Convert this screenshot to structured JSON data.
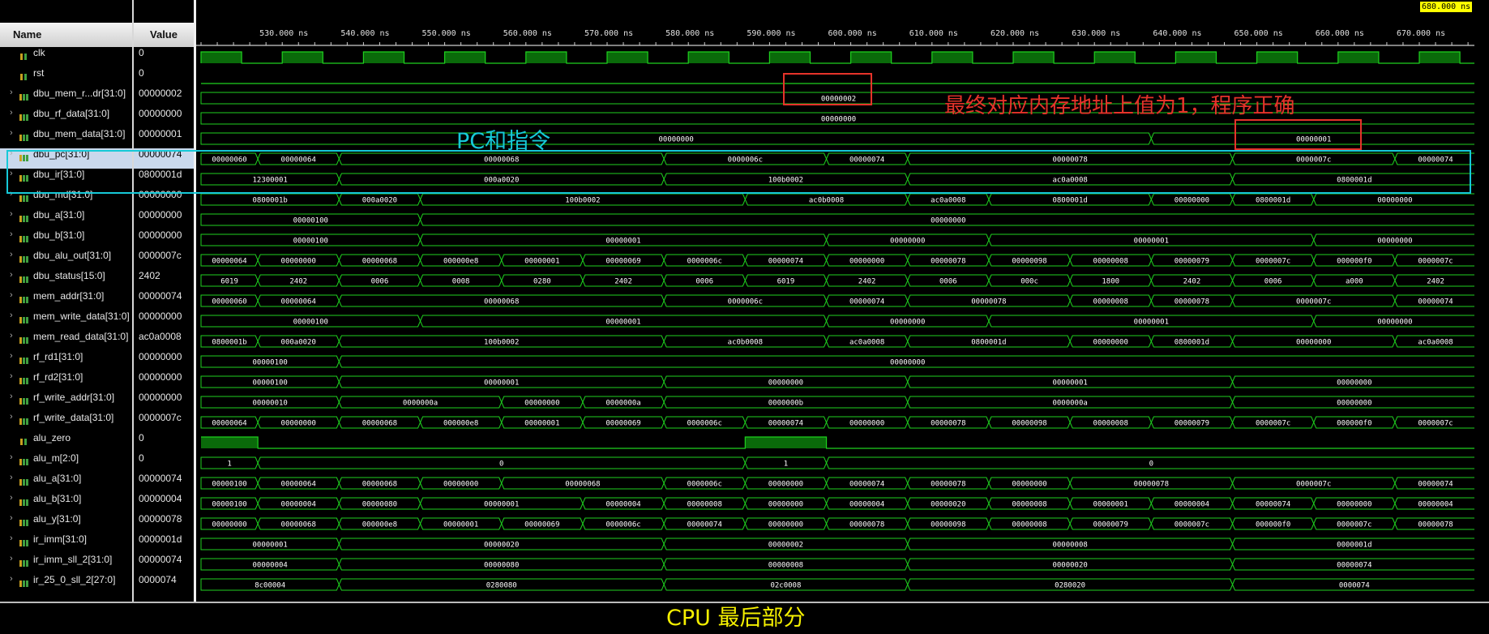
{
  "header": {
    "name_col": "Name",
    "value_col": "Value"
  },
  "ruler": {
    "ticks": [
      "530.000 ns",
      "540.000 ns",
      "550.000 ns",
      "560.000 ns",
      "570.000 ns",
      "580.000 ns",
      "590.000 ns",
      "600.000 ns",
      "610.000 ns",
      "620.000 ns",
      "630.000 ns",
      "640.000 ns",
      "650.000 ns",
      "660.000 ns",
      "670.000 ns",
      "680"
    ],
    "cursor_label": "680.000 ns"
  },
  "signals": [
    {
      "name": "clk",
      "value": "0",
      "kind": "bit",
      "expand": false
    },
    {
      "name": "rst",
      "value": "0",
      "kind": "bit",
      "expand": false
    },
    {
      "name": "dbu_mem_r...dr[31:0]",
      "value": "00000002",
      "kind": "bus",
      "expand": true
    },
    {
      "name": "dbu_rf_data[31:0]",
      "value": "00000000",
      "kind": "bus",
      "expand": true
    },
    {
      "name": "dbu_mem_data[31:0]",
      "value": "00000001",
      "kind": "bus",
      "expand": true
    },
    {
      "name": "dbu_pc[31:0]",
      "value": "00000074",
      "kind": "bus",
      "expand": true,
      "selected": true
    },
    {
      "name": "dbu_ir[31:0]",
      "value": "0800001d",
      "kind": "bus",
      "expand": true
    },
    {
      "name": "dbu_md[31:0]",
      "value": "00000000",
      "kind": "bus",
      "expand": true
    },
    {
      "name": "dbu_a[31:0]",
      "value": "00000000",
      "kind": "bus",
      "expand": true
    },
    {
      "name": "dbu_b[31:0]",
      "value": "00000000",
      "kind": "bus",
      "expand": true
    },
    {
      "name": "dbu_alu_out[31:0]",
      "value": "0000007c",
      "kind": "bus",
      "expand": true
    },
    {
      "name": "dbu_status[15:0]",
      "value": "2402",
      "kind": "bus",
      "expand": true
    },
    {
      "name": "mem_addr[31:0]",
      "value": "00000074",
      "kind": "bus",
      "expand": true
    },
    {
      "name": "mem_write_data[31:0]",
      "value": "00000000",
      "kind": "bus",
      "expand": true
    },
    {
      "name": "mem_read_data[31:0]",
      "value": "ac0a0008",
      "kind": "bus",
      "expand": true
    },
    {
      "name": "rf_rd1[31:0]",
      "value": "00000000",
      "kind": "bus",
      "expand": true
    },
    {
      "name": "rf_rd2[31:0]",
      "value": "00000000",
      "kind": "bus",
      "expand": true
    },
    {
      "name": "rf_write_addr[31:0]",
      "value": "00000000",
      "kind": "bus",
      "expand": true
    },
    {
      "name": "rf_write_data[31:0]",
      "value": "0000007c",
      "kind": "bus",
      "expand": true
    },
    {
      "name": "alu_zero",
      "value": "0",
      "kind": "bit",
      "expand": false
    },
    {
      "name": "alu_m[2:0]",
      "value": "0",
      "kind": "bus",
      "expand": true
    },
    {
      "name": "alu_a[31:0]",
      "value": "00000074",
      "kind": "bus",
      "expand": true
    },
    {
      "name": "alu_b[31:0]",
      "value": "00000004",
      "kind": "bus",
      "expand": true
    },
    {
      "name": "alu_y[31:0]",
      "value": "00000078",
      "kind": "bus",
      "expand": true
    },
    {
      "name": "ir_imm[31:0]",
      "value": "0000001d",
      "kind": "bus",
      "expand": true
    },
    {
      "name": "ir_imm_sll_2[31:0]",
      "value": "00000074",
      "kind": "bus",
      "expand": true
    },
    {
      "name": "ir_25_0_sll_2[27:0]",
      "value": "0000074",
      "kind": "bus",
      "expand": true
    }
  ],
  "waves": {
    "clk": {
      "t0": 523,
      "period": 10,
      "high": 5
    },
    "rst": [],
    "alu_zero": [
      [
        523,
        530,
        1
      ],
      [
        530,
        590,
        0
      ],
      [
        590,
        600,
        1
      ],
      [
        600,
        680,
        0
      ]
    ],
    "dbu_mem_r...dr[31:0]": [
      [
        523,
        680,
        "00000002"
      ]
    ],
    "dbu_rf_data[31:0]": [
      [
        523,
        680,
        "00000000"
      ]
    ],
    "dbu_mem_data[31:0]": [
      [
        523,
        640,
        "00000000"
      ],
      [
        640,
        680,
        "00000001"
      ]
    ],
    "dbu_pc[31:0]": [
      [
        523,
        530,
        "00000060"
      ],
      [
        530,
        540,
        "00000064"
      ],
      [
        540,
        580,
        "00000068"
      ],
      [
        580,
        600,
        "0000006c"
      ],
      [
        600,
        610,
        "00000074"
      ],
      [
        610,
        650,
        "00000078"
      ],
      [
        650,
        670,
        "0000007c"
      ],
      [
        670,
        680,
        "00000074"
      ]
    ],
    "dbu_ir[31:0]": [
      [
        523,
        540,
        "12300001"
      ],
      [
        540,
        580,
        "000a0020"
      ],
      [
        580,
        610,
        "100b0002"
      ],
      [
        610,
        650,
        "ac0a0008"
      ],
      [
        650,
        680,
        "0800001d"
      ]
    ],
    "dbu_md[31:0]": [
      [
        523,
        540,
        "0800001b"
      ],
      [
        540,
        550,
        "000a0020"
      ],
      [
        550,
        590,
        "100b0002"
      ],
      [
        590,
        610,
        "ac0b0008"
      ],
      [
        610,
        620,
        "ac0a0008"
      ],
      [
        620,
        640,
        "0800001d"
      ],
      [
        640,
        650,
        "00000000"
      ],
      [
        650,
        660,
        "0800001d"
      ],
      [
        660,
        680,
        "00000000"
      ]
    ],
    "dbu_a[31:0]": [
      [
        523,
        550,
        "00000100"
      ],
      [
        550,
        680,
        "00000000"
      ]
    ],
    "dbu_b[31:0]": [
      [
        523,
        550,
        "00000100"
      ],
      [
        550,
        600,
        "00000001"
      ],
      [
        600,
        620,
        "00000000"
      ],
      [
        620,
        660,
        "00000001"
      ],
      [
        660,
        680,
        "00000000"
      ]
    ],
    "dbu_alu_out[31:0]": [
      [
        523,
        530,
        "00000064"
      ],
      [
        530,
        540,
        "00000000"
      ],
      [
        540,
        550,
        "00000068"
      ],
      [
        550,
        560,
        "000000e8"
      ],
      [
        560,
        570,
        "00000001"
      ],
      [
        570,
        580,
        "00000069"
      ],
      [
        580,
        590,
        "0000006c"
      ],
      [
        590,
        600,
        "00000074"
      ],
      [
        600,
        610,
        "00000000"
      ],
      [
        610,
        620,
        "00000078"
      ],
      [
        620,
        630,
        "00000098"
      ],
      [
        630,
        640,
        "00000008"
      ],
      [
        640,
        650,
        "00000079"
      ],
      [
        650,
        660,
        "0000007c"
      ],
      [
        660,
        670,
        "000000f0"
      ],
      [
        670,
        680,
        "0000007c"
      ]
    ],
    "dbu_status[15:0]": [
      [
        523,
        530,
        "6019"
      ],
      [
        530,
        540,
        "2402"
      ],
      [
        540,
        550,
        "0006"
      ],
      [
        550,
        560,
        "0008"
      ],
      [
        560,
        570,
        "0280"
      ],
      [
        570,
        580,
        "2402"
      ],
      [
        580,
        590,
        "0006"
      ],
      [
        590,
        600,
        "6019"
      ],
      [
        600,
        610,
        "2402"
      ],
      [
        610,
        620,
        "0006"
      ],
      [
        620,
        630,
        "000c"
      ],
      [
        630,
        640,
        "1800"
      ],
      [
        640,
        650,
        "2402"
      ],
      [
        650,
        660,
        "0006"
      ],
      [
        660,
        670,
        "a000"
      ],
      [
        670,
        680,
        "2402"
      ]
    ],
    "mem_addr[31:0]": [
      [
        523,
        530,
        "00000060"
      ],
      [
        530,
        540,
        "00000064"
      ],
      [
        540,
        580,
        "00000068"
      ],
      [
        580,
        600,
        "0000006c"
      ],
      [
        600,
        610,
        "00000074"
      ],
      [
        610,
        630,
        "00000078"
      ],
      [
        630,
        640,
        "00000008"
      ],
      [
        640,
        650,
        "00000078"
      ],
      [
        650,
        670,
        "0000007c"
      ],
      [
        670,
        680,
        "00000074"
      ]
    ],
    "mem_write_data[31:0]": [
      [
        523,
        550,
        "00000100"
      ],
      [
        550,
        600,
        "00000001"
      ],
      [
        600,
        620,
        "00000000"
      ],
      [
        620,
        660,
        "00000001"
      ],
      [
        660,
        680,
        "00000000"
      ]
    ],
    "mem_read_data[31:0]": [
      [
        523,
        530,
        "0800001b"
      ],
      [
        530,
        540,
        "000a0020"
      ],
      [
        540,
        580,
        "100b0002"
      ],
      [
        580,
        600,
        "ac0b0008"
      ],
      [
        600,
        610,
        "ac0a0008"
      ],
      [
        610,
        630,
        "0800001d"
      ],
      [
        630,
        640,
        "00000000"
      ],
      [
        640,
        650,
        "0800001d"
      ],
      [
        650,
        670,
        "00000000"
      ],
      [
        670,
        680,
        "ac0a0008"
      ]
    ],
    "rf_rd1[31:0]": [
      [
        523,
        540,
        "00000100"
      ],
      [
        540,
        680,
        "00000000"
      ]
    ],
    "rf_rd2[31:0]": [
      [
        523,
        540,
        "00000100"
      ],
      [
        540,
        580,
        "00000001"
      ],
      [
        580,
        610,
        "00000000"
      ],
      [
        610,
        650,
        "00000001"
      ],
      [
        650,
        680,
        "00000000"
      ]
    ],
    "rf_write_addr[31:0]": [
      [
        523,
        540,
        "00000010"
      ],
      [
        540,
        560,
        "0000000a"
      ],
      [
        560,
        570,
        "00000000"
      ],
      [
        570,
        580,
        "0000000a"
      ],
      [
        580,
        610,
        "0000000b"
      ],
      [
        610,
        650,
        "0000000a"
      ],
      [
        650,
        680,
        "00000000"
      ]
    ],
    "rf_write_data[31:0]": [
      [
        523,
        530,
        "00000064"
      ],
      [
        530,
        540,
        "00000000"
      ],
      [
        540,
        550,
        "00000068"
      ],
      [
        550,
        560,
        "000000e8"
      ],
      [
        560,
        570,
        "00000001"
      ],
      [
        570,
        580,
        "00000069"
      ],
      [
        580,
        590,
        "0000006c"
      ],
      [
        590,
        600,
        "00000074"
      ],
      [
        600,
        610,
        "00000000"
      ],
      [
        610,
        620,
        "00000078"
      ],
      [
        620,
        630,
        "00000098"
      ],
      [
        630,
        640,
        "00000008"
      ],
      [
        640,
        650,
        "00000079"
      ],
      [
        650,
        660,
        "0000007c"
      ],
      [
        660,
        670,
        "000000f0"
      ],
      [
        670,
        680,
        "0000007c"
      ]
    ],
    "alu_m[2:0]": [
      [
        523,
        530,
        "1"
      ],
      [
        530,
        590,
        "0"
      ],
      [
        590,
        600,
        "1"
      ],
      [
        600,
        680,
        "0"
      ]
    ],
    "alu_a[31:0]": [
      [
        523,
        530,
        "00000100"
      ],
      [
        530,
        540,
        "00000064"
      ],
      [
        540,
        550,
        "00000068"
      ],
      [
        550,
        560,
        "00000000"
      ],
      [
        560,
        580,
        "00000068"
      ],
      [
        580,
        590,
        "0000006c"
      ],
      [
        590,
        600,
        "00000000"
      ],
      [
        600,
        610,
        "00000074"
      ],
      [
        610,
        620,
        "00000078"
      ],
      [
        620,
        630,
        "00000000"
      ],
      [
        630,
        650,
        "00000078"
      ],
      [
        650,
        670,
        "0000007c"
      ],
      [
        670,
        680,
        "00000074"
      ]
    ],
    "alu_b[31:0]": [
      [
        523,
        530,
        "00000100"
      ],
      [
        530,
        540,
        "00000004"
      ],
      [
        540,
        550,
        "00000080"
      ],
      [
        550,
        570,
        "00000001"
      ],
      [
        570,
        580,
        "00000004"
      ],
      [
        580,
        590,
        "00000008"
      ],
      [
        590,
        600,
        "00000000"
      ],
      [
        600,
        610,
        "00000004"
      ],
      [
        610,
        620,
        "00000020"
      ],
      [
        620,
        630,
        "00000008"
      ],
      [
        630,
        640,
        "00000001"
      ],
      [
        640,
        650,
        "00000004"
      ],
      [
        650,
        660,
        "00000074"
      ],
      [
        660,
        670,
        "00000000"
      ],
      [
        670,
        680,
        "00000004"
      ]
    ],
    "alu_y[31:0]": [
      [
        523,
        530,
        "00000000"
      ],
      [
        530,
        540,
        "00000068"
      ],
      [
        540,
        550,
        "000000e8"
      ],
      [
        550,
        560,
        "00000001"
      ],
      [
        560,
        570,
        "00000069"
      ],
      [
        570,
        580,
        "0000006c"
      ],
      [
        580,
        590,
        "00000074"
      ],
      [
        590,
        600,
        "00000000"
      ],
      [
        600,
        610,
        "00000078"
      ],
      [
        610,
        620,
        "00000098"
      ],
      [
        620,
        630,
        "00000008"
      ],
      [
        630,
        640,
        "00000079"
      ],
      [
        640,
        650,
        "0000007c"
      ],
      [
        650,
        660,
        "000000f0"
      ],
      [
        660,
        670,
        "0000007c"
      ],
      [
        670,
        680,
        "00000078"
      ]
    ],
    "ir_imm[31:0]": [
      [
        523,
        540,
        "00000001"
      ],
      [
        540,
        580,
        "00000020"
      ],
      [
        580,
        610,
        "00000002"
      ],
      [
        610,
        650,
        "00000008"
      ],
      [
        650,
        680,
        "0000001d"
      ]
    ],
    "ir_imm_sll_2[31:0]": [
      [
        523,
        540,
        "00000004"
      ],
      [
        540,
        580,
        "00000080"
      ],
      [
        580,
        610,
        "00000008"
      ],
      [
        610,
        650,
        "00000020"
      ],
      [
        650,
        680,
        "00000074"
      ]
    ],
    "ir_25_0_sll_2[27:0]": [
      [
        523,
        540,
        "8c00004"
      ],
      [
        540,
        580,
        "0280080"
      ],
      [
        580,
        610,
        "02c0008"
      ],
      [
        610,
        650,
        "0280020"
      ],
      [
        650,
        680,
        "0000074"
      ]
    ]
  },
  "annotations": {
    "red_text": "最终对应内存地址上值为1，程序正确",
    "cyan_text": "PC和指令",
    "caption": "CPU 最后部分"
  },
  "colors": {
    "wave": "#1fd11f",
    "bit_high_fill": "#0a6a0a",
    "cursor": "#ffff00",
    "red_box": "#e6332a",
    "cyan_box": "#16c9d8"
  }
}
